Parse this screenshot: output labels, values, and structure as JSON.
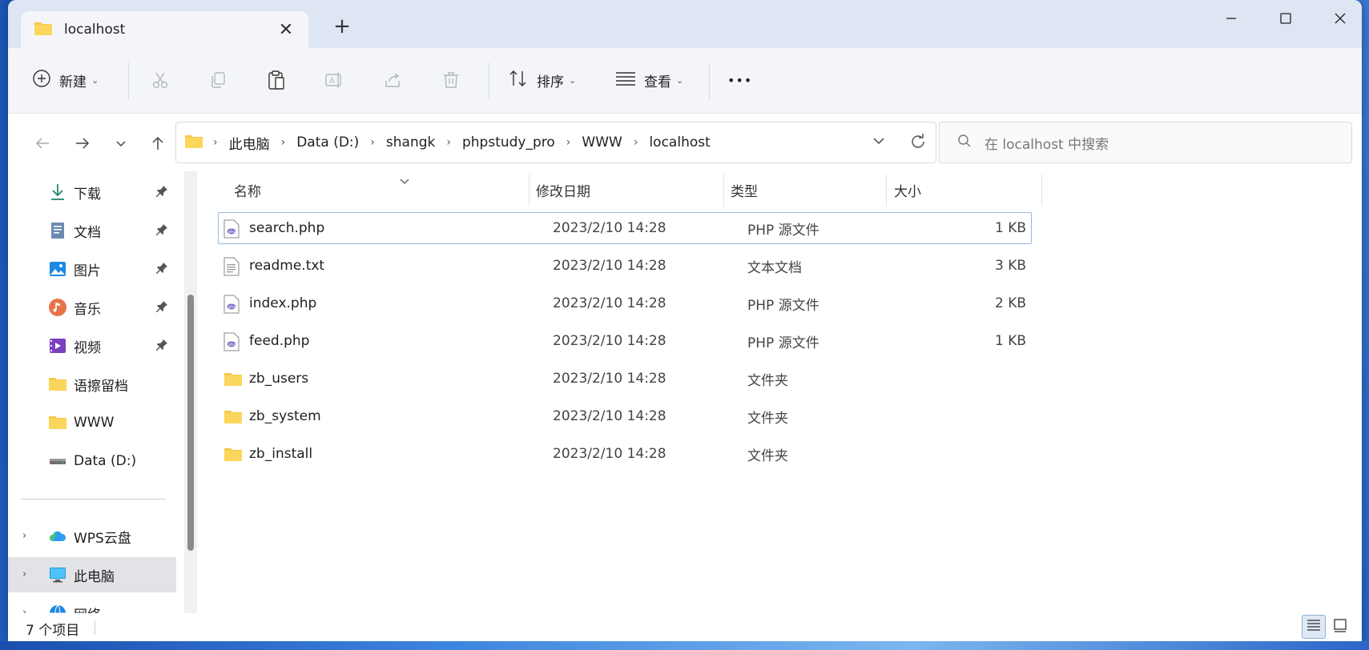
{
  "window": {
    "tab_title": "localhost",
    "new_tab_symbol": "+"
  },
  "toolbar": {
    "new_label": "新建",
    "sort_label": "排序",
    "view_label": "查看",
    "more_label": "•••"
  },
  "address": {
    "crumbs": [
      "此电脑",
      "Data (D:)",
      "shangk",
      "phpstudy_pro",
      "WWW",
      "localhost"
    ],
    "search_placeholder": "在 localhost 中搜索"
  },
  "sidebar": {
    "items": [
      {
        "label": "下载",
        "icon": "download-icon",
        "pinned": true
      },
      {
        "label": "文档",
        "icon": "documents-icon",
        "pinned": true
      },
      {
        "label": "图片",
        "icon": "pictures-icon",
        "pinned": true
      },
      {
        "label": "音乐",
        "icon": "music-icon",
        "pinned": true
      },
      {
        "label": "视频",
        "icon": "video-icon",
        "pinned": true
      },
      {
        "label": "语擦留档",
        "icon": "folder-icon",
        "pinned": false
      },
      {
        "label": "WWW",
        "icon": "folder-icon",
        "pinned": false
      },
      {
        "label": "Data (D:)",
        "icon": "drive-icon",
        "pinned": false
      }
    ],
    "tree": [
      {
        "label": "WPS云盘",
        "icon": "cloud-icon"
      },
      {
        "label": "此电脑",
        "icon": "computer-icon",
        "selected": true
      },
      {
        "label": "网络",
        "icon": "network-icon"
      }
    ]
  },
  "columns": {
    "name": "名称",
    "modified": "修改日期",
    "type": "类型",
    "size": "大小"
  },
  "files": [
    {
      "name": "search.php",
      "modified": "2023/2/10 14:28",
      "type": "PHP 源文件",
      "size": "1 KB",
      "kind": "php",
      "selected": true
    },
    {
      "name": "readme.txt",
      "modified": "2023/2/10 14:28",
      "type": "文本文档",
      "size": "3 KB",
      "kind": "txt"
    },
    {
      "name": "index.php",
      "modified": "2023/2/10 14:28",
      "type": "PHP 源文件",
      "size": "2 KB",
      "kind": "php"
    },
    {
      "name": "feed.php",
      "modified": "2023/2/10 14:28",
      "type": "PHP 源文件",
      "size": "1 KB",
      "kind": "php"
    },
    {
      "name": "zb_users",
      "modified": "2023/2/10 14:28",
      "type": "文件夹",
      "size": "",
      "kind": "folder"
    },
    {
      "name": "zb_system",
      "modified": "2023/2/10 14:28",
      "type": "文件夹",
      "size": "",
      "kind": "folder"
    },
    {
      "name": "zb_install",
      "modified": "2023/2/10 14:28",
      "type": "文件夹",
      "size": "",
      "kind": "folder"
    }
  ],
  "status": {
    "item_count": "7 个项目"
  },
  "colors": {
    "folder": "#f7c948",
    "selection_border": "#94b8e0",
    "titlebar_bg": "#dde6f2"
  }
}
